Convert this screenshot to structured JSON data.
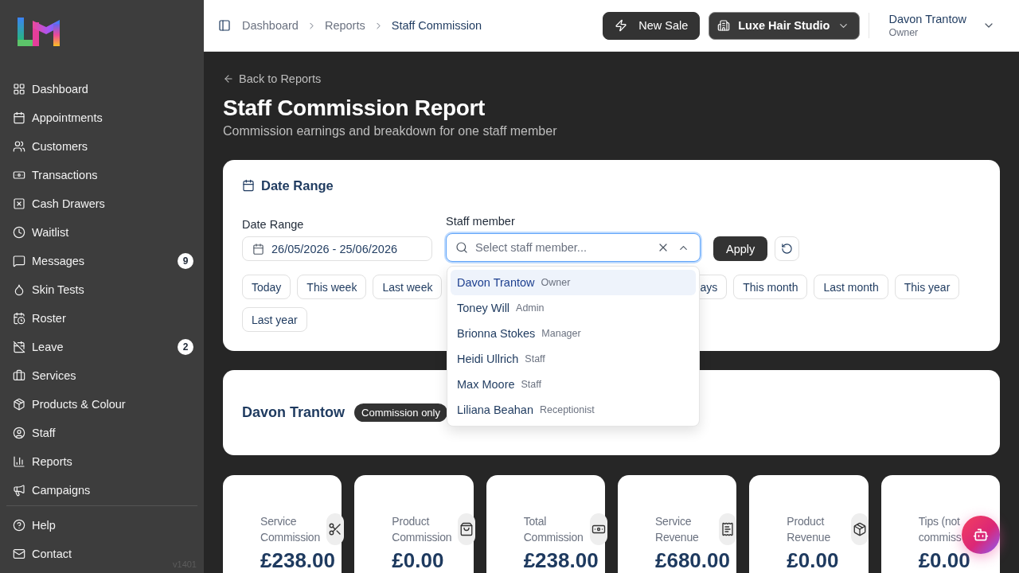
{
  "sidebar": {
    "nav_items": [
      {
        "label": "Dashboard"
      },
      {
        "label": "Appointments"
      },
      {
        "label": "Customers"
      },
      {
        "label": "Transactions"
      },
      {
        "label": "Cash Drawers"
      },
      {
        "label": "Waitlist"
      },
      {
        "label": "Messages",
        "badge": "9"
      },
      {
        "label": "Skin Tests"
      },
      {
        "label": "Roster"
      },
      {
        "label": "Leave",
        "badge": "2"
      },
      {
        "label": "Services"
      },
      {
        "label": "Products & Colour"
      },
      {
        "label": "Staff"
      },
      {
        "label": "Reports"
      },
      {
        "label": "Campaigns"
      }
    ],
    "footer_items": [
      {
        "label": "Help"
      },
      {
        "label": "Contact"
      }
    ],
    "version": "v1401"
  },
  "header": {
    "breadcrumbs": [
      {
        "label": "Dashboard",
        "current": false
      },
      {
        "label": "Reports",
        "current": false
      },
      {
        "label": "Staff Commission",
        "current": true
      }
    ],
    "new_sale_button": "New Sale",
    "business_selector": "Luxe Hair Studio",
    "user": {
      "name": "Davon Trantow",
      "role": "Owner"
    }
  },
  "page": {
    "back_link": "Back to Reports",
    "title": "Staff Commission Report",
    "subtitle": "Commission earnings and breakdown for one staff member"
  },
  "filters": {
    "heading": "Date Range",
    "date_range": {
      "label": "Date Range",
      "value": "26/05/2026 - 25/06/2026"
    },
    "staff_select": {
      "label": "Staff member",
      "placeholder": "Select staff member...",
      "expanded": true,
      "options": [
        {
          "name": "Davon Trantow",
          "role": "Owner",
          "selected": true
        },
        {
          "name": "Toney Will",
          "role": "Admin",
          "selected": false
        },
        {
          "name": "Brionna Stokes",
          "role": "Manager",
          "selected": false
        },
        {
          "name": "Heidi Ullrich",
          "role": "Staff",
          "selected": false
        },
        {
          "name": "Max Moore",
          "role": "Staff",
          "selected": false
        },
        {
          "name": "Liliana Beahan",
          "role": "Receptionist",
          "selected": false
        }
      ]
    },
    "apply_button": "Apply",
    "presets": [
      {
        "label": "Today",
        "covered": false
      },
      {
        "label": "This week",
        "covered": false
      },
      {
        "label": "Last week",
        "covered": false
      },
      {
        "label": "ays",
        "covered": true
      },
      {
        "label": "This month",
        "covered": false
      },
      {
        "label": "Last month",
        "covered": false
      },
      {
        "label": "This year",
        "covered": false
      },
      {
        "label": "Last year",
        "covered": false
      }
    ]
  },
  "staff_summary": {
    "name": "Davon Trantow",
    "badge": "Commission only"
  },
  "stats": [
    {
      "label": "Service Commission",
      "value": "£238.00"
    },
    {
      "label": "Product Commission",
      "value": "£0.00"
    },
    {
      "label": "Total Commission",
      "value": "£238.00"
    },
    {
      "label": "Service Revenue",
      "value": "£680.00"
    },
    {
      "label": "Product Revenue",
      "value": "£0.00"
    },
    {
      "label": "Tips (not commiss",
      "value": "£0.00"
    }
  ]
}
